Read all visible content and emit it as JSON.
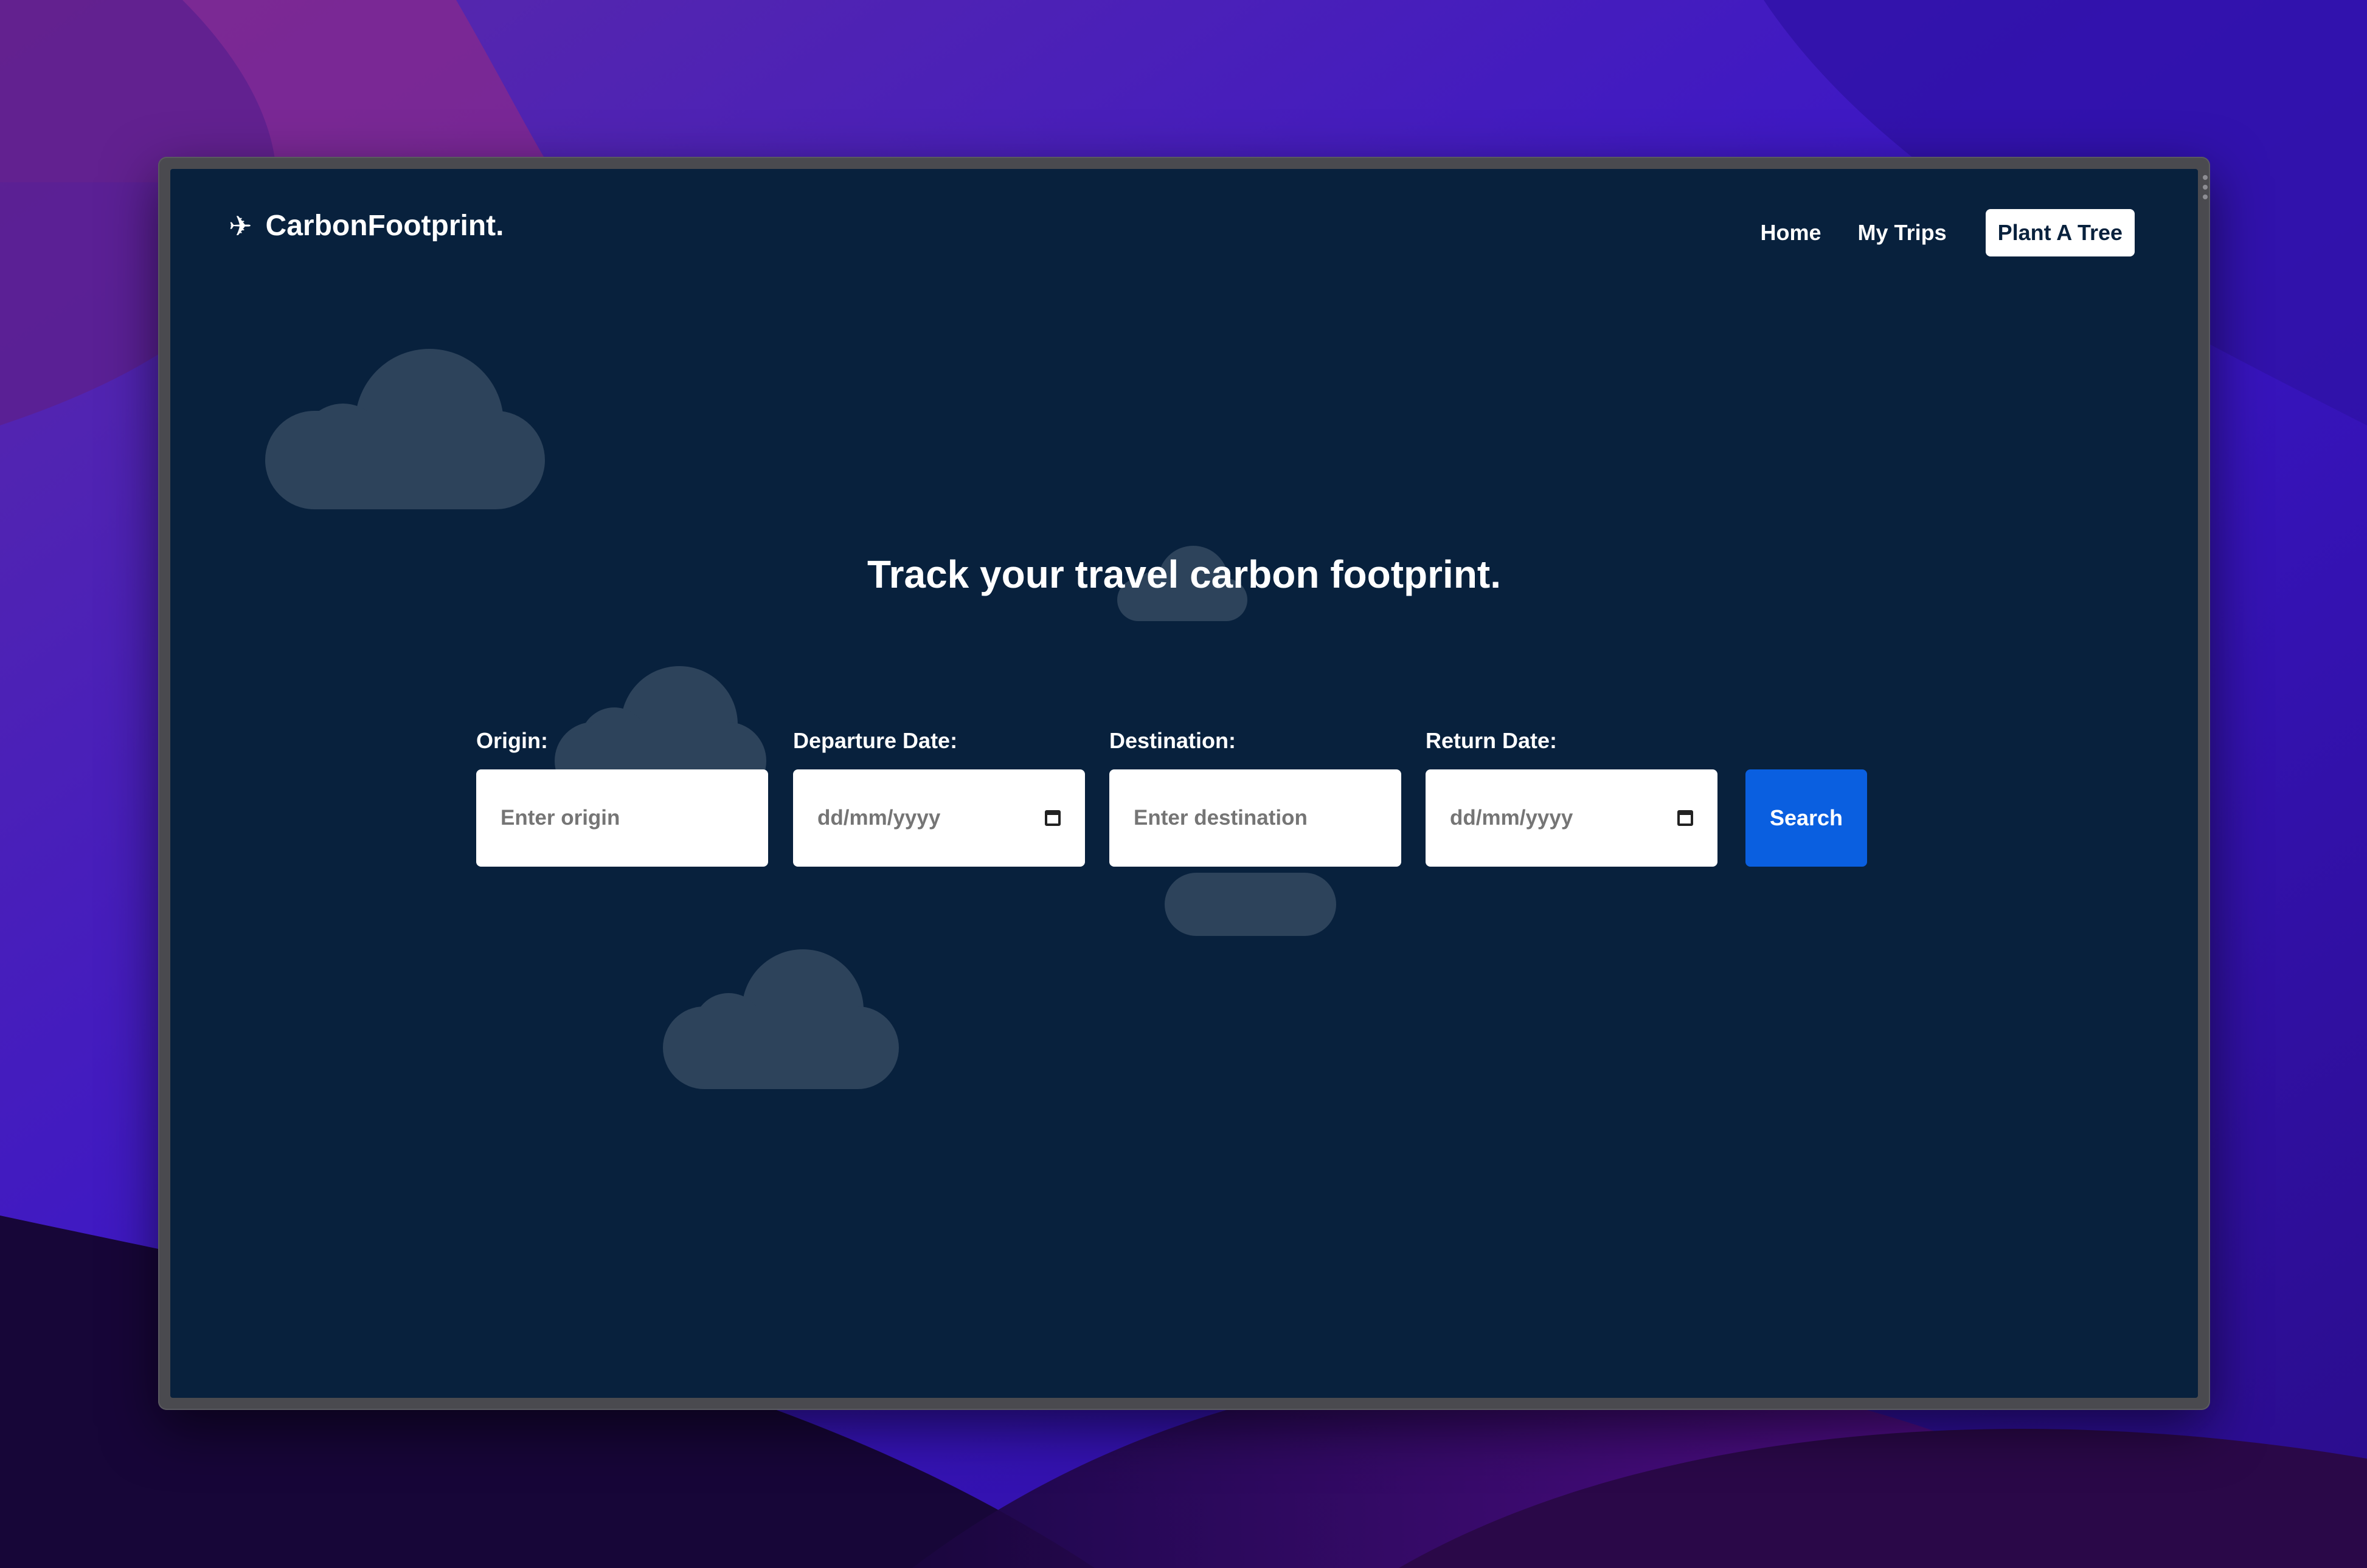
{
  "nav": {
    "brand_icon": "airplane-icon",
    "brand": "CarbonFootprint.",
    "links": [
      "Home",
      "My Trips"
    ],
    "cta": "Plant A Tree"
  },
  "hero": {
    "headline": "Track your travel carbon footprint."
  },
  "form": {
    "origin": {
      "label": "Origin:",
      "placeholder": "Enter origin"
    },
    "departure": {
      "label": "Departure Date:",
      "placeholder": "dd/mm/yyyy"
    },
    "destination": {
      "label": "Destination:",
      "placeholder": "Enter destination"
    },
    "return": {
      "label": "Return Date:",
      "placeholder": "dd/mm/yyyy"
    },
    "search_label": "Search"
  },
  "colors": {
    "page_background": "#08213d",
    "cloud": "#2d435b",
    "search_button": "#0a5fe0"
  }
}
